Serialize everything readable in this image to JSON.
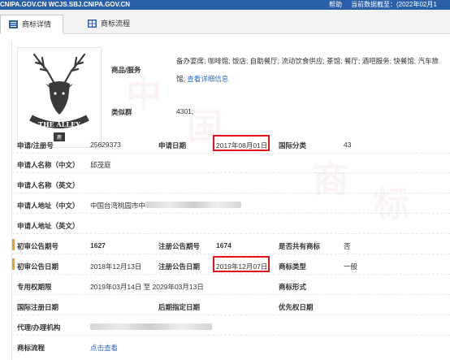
{
  "topbar": {
    "site": "CNIPA.GOV.CN WCJS.SBJ.CNIPA.GOV.CN",
    "help": "帮助",
    "as_of": "当前数据截至：(2022年02月1"
  },
  "tabs": [
    {
      "label": "商标详情",
      "icon": "list-icon",
      "active": true
    },
    {
      "label": "商标流程",
      "icon": "grid-icon",
      "active": false
    }
  ],
  "logo": {
    "text": "THE ALLEY"
  },
  "goods": {
    "label": "商品/服务",
    "text": "备办宴席; 咖啡馆; 饭店; 自助餐厅; 流动饮食供应; 茶馆; 餐厅; 酒吧服务; 快餐馆; 汽车旅馆;",
    "link": "查看详细信息"
  },
  "similar_group": {
    "label": "类似群",
    "value": "4301;"
  },
  "fields": {
    "reg_no_label": "申请/注册号",
    "reg_no": "25629373",
    "app_date_label": "申请日期",
    "app_date": "2017年08月01日",
    "intl_class_label": "国际分类",
    "intl_class": "43",
    "applicant_cn_label": "申请人名称（中文）",
    "applicant_cn": "邱茂庭",
    "applicant_en_label": "申请人名称（英文）",
    "address_cn_label": "申请人地址（中文）",
    "address_cn": "中国台湾桃园市中",
    "address_en_label": "申请人地址（英文）",
    "prelim_no_label": "初审公告期号",
    "prelim_no": "1627",
    "reg_pub_no_label": "注册公告期号",
    "reg_pub_no": "1674",
    "shared_label": "是否共有商标",
    "shared": "否",
    "prelim_date_label": "初审公告日期",
    "prelim_date": "2018年12月13日",
    "reg_pub_date_label": "注册公告日期",
    "reg_pub_date": "2019年12月07日",
    "type_label": "商标类型",
    "type": "一般",
    "exclusive_label": "专用权期限",
    "exclusive": "2019年03月14日 至 2029年03月13日",
    "form_label": "商标形式",
    "intl_reg_date_label": "国际注册日期",
    "later_date_label": "后期指定日期",
    "priority_label": "优先权日期",
    "agent_label": "代理/办理机构",
    "flow_label": "商标流程",
    "flow_link": "点击查看"
  },
  "watermark": [
    "中",
    "国",
    "商",
    "标"
  ],
  "colors": {
    "accent": "#2b5fa8",
    "highlight": "#e0141e",
    "link": "#2c6cc7"
  }
}
